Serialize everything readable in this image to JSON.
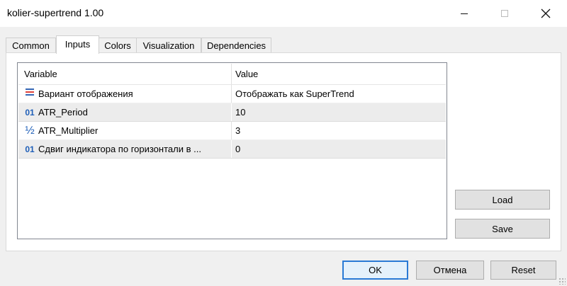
{
  "window": {
    "title": "kolier-supertrend 1.00"
  },
  "tabs": [
    {
      "label": "Common",
      "active": false
    },
    {
      "label": "Inputs",
      "active": true
    },
    {
      "label": "Colors",
      "active": false
    },
    {
      "label": "Visualization",
      "active": false
    },
    {
      "label": "Dependencies",
      "active": false
    }
  ],
  "grid": {
    "headers": {
      "variable": "Variable",
      "value": "Value"
    },
    "rows": [
      {
        "icon": "enum-icon",
        "variable": "Вариант отображения",
        "value": "Отображать как SuperTrend"
      },
      {
        "icon": "int-icon",
        "icon_text": "01",
        "variable": "ATR_Period",
        "value": "10"
      },
      {
        "icon": "fraction-icon",
        "icon_text": "½",
        "variable": "ATR_Multiplier",
        "value": "3"
      },
      {
        "icon": "int-icon",
        "icon_text": "01",
        "variable": "Сдвиг индикатора по горизонтали в ...",
        "value": "0"
      }
    ]
  },
  "side_buttons": {
    "load": "Load",
    "save": "Save"
  },
  "footer_buttons": {
    "ok": "OK",
    "cancel": "Отмена",
    "reset": "Reset"
  },
  "colors": {
    "default_button_border": "#2a7ad5",
    "icon_blue": "#1f5fb8",
    "enum_red": "#e0423a"
  }
}
